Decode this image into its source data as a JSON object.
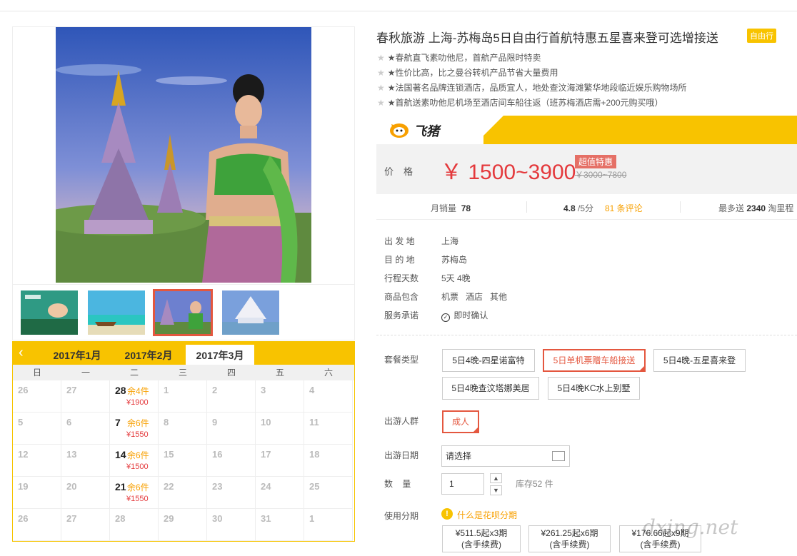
{
  "product": {
    "title": "春秋旅游 上海-苏梅岛5日自由行首航特惠五星喜来登可选增接送",
    "badge": "自由行",
    "features": [
      "★春航直飞素叻他尼，首航产品限时特卖",
      "★性价比高，比之曼谷转机产品节省大量费用",
      "★法国著名品牌连锁酒店，品质宜人，地处查汶海滩繁华地段临近娱乐购物场所",
      "★首航送素叻他尼机场至酒店间车船往返（班苏梅酒店需+200元购买哦）"
    ]
  },
  "brand": {
    "name": "飞猪",
    "color": "#f8c300"
  },
  "price": {
    "label": "价格",
    "main": "￥ 1500~3900",
    "tag": "超值特惠",
    "original": "￥3000~7800"
  },
  "stats": {
    "sales_label": "月销量",
    "sales_value": "78",
    "rating": "4.8",
    "rating_suffix": "/5分",
    "reviews": "81 条评论",
    "points_prefix": "最多送",
    "points_value": "2340",
    "points_suffix": "淘里程"
  },
  "info": [
    {
      "label": "出 发 地",
      "value": "上海"
    },
    {
      "label": "目 的 地",
      "value": "苏梅岛"
    },
    {
      "label": "行程天数",
      "value": "5天 4晚"
    },
    {
      "label": "商品包含",
      "value": "机票   酒店   其他"
    },
    {
      "label": "服务承诺",
      "value": "即时确认"
    }
  ],
  "form": {
    "package_label": "套餐类型",
    "packages": [
      "5日4晚-四星诺富特",
      "5日单机票赠车船接送",
      "5日4晚-五星喜来登",
      "5日4晚查汶塔娜美居",
      "5日4晚KC水上别墅"
    ],
    "group_label": "出游人群",
    "group_option": "成人",
    "date_label": "出游日期",
    "date_placeholder": "请选择",
    "qty_label": "数    量",
    "qty_value": "1",
    "stock": "库存52 件",
    "installment_label": "使用分期",
    "installment_link": "什么是花呗分期",
    "installments": [
      {
        "line1": "¥511.5起x3期",
        "line2": "(含手续费)"
      },
      {
        "line1": "¥261.25起x6期",
        "line2": "(含手续费)"
      },
      {
        "line1": "¥176.66起x9期",
        "line2": "(含手续费)"
      }
    ]
  },
  "calendar": {
    "tabs": [
      "2017年1月",
      "2017年2月",
      "2017年3月"
    ],
    "weekdays": [
      "日",
      "一",
      "二",
      "三",
      "四",
      "五",
      "六"
    ],
    "rows": [
      [
        {
          "d": "26"
        },
        {
          "d": "27"
        },
        {
          "d": "28",
          "stock": "余4件",
          "price": "¥1900"
        },
        {
          "d": "1"
        },
        {
          "d": "2"
        },
        {
          "d": "3"
        },
        {
          "d": "4"
        }
      ],
      [
        {
          "d": "5"
        },
        {
          "d": "6"
        },
        {
          "d": "7",
          "stock": "余6件",
          "price": "¥1550"
        },
        {
          "d": "8"
        },
        {
          "d": "9"
        },
        {
          "d": "10"
        },
        {
          "d": "11"
        }
      ],
      [
        {
          "d": "12"
        },
        {
          "d": "13"
        },
        {
          "d": "14",
          "stock": "余6件",
          "price": "¥1500"
        },
        {
          "d": "15"
        },
        {
          "d": "16"
        },
        {
          "d": "17"
        },
        {
          "d": "18"
        }
      ],
      [
        {
          "d": "19"
        },
        {
          "d": "20"
        },
        {
          "d": "21",
          "stock": "余6件",
          "price": "¥1550"
        },
        {
          "d": "22"
        },
        {
          "d": "23"
        },
        {
          "d": "24"
        },
        {
          "d": "25"
        }
      ],
      [
        {
          "d": "26"
        },
        {
          "d": "27"
        },
        {
          "d": "28"
        },
        {
          "d": "29"
        },
        {
          "d": "30"
        },
        {
          "d": "31"
        },
        {
          "d": "1"
        }
      ]
    ]
  },
  "watermark": "dxing.net"
}
